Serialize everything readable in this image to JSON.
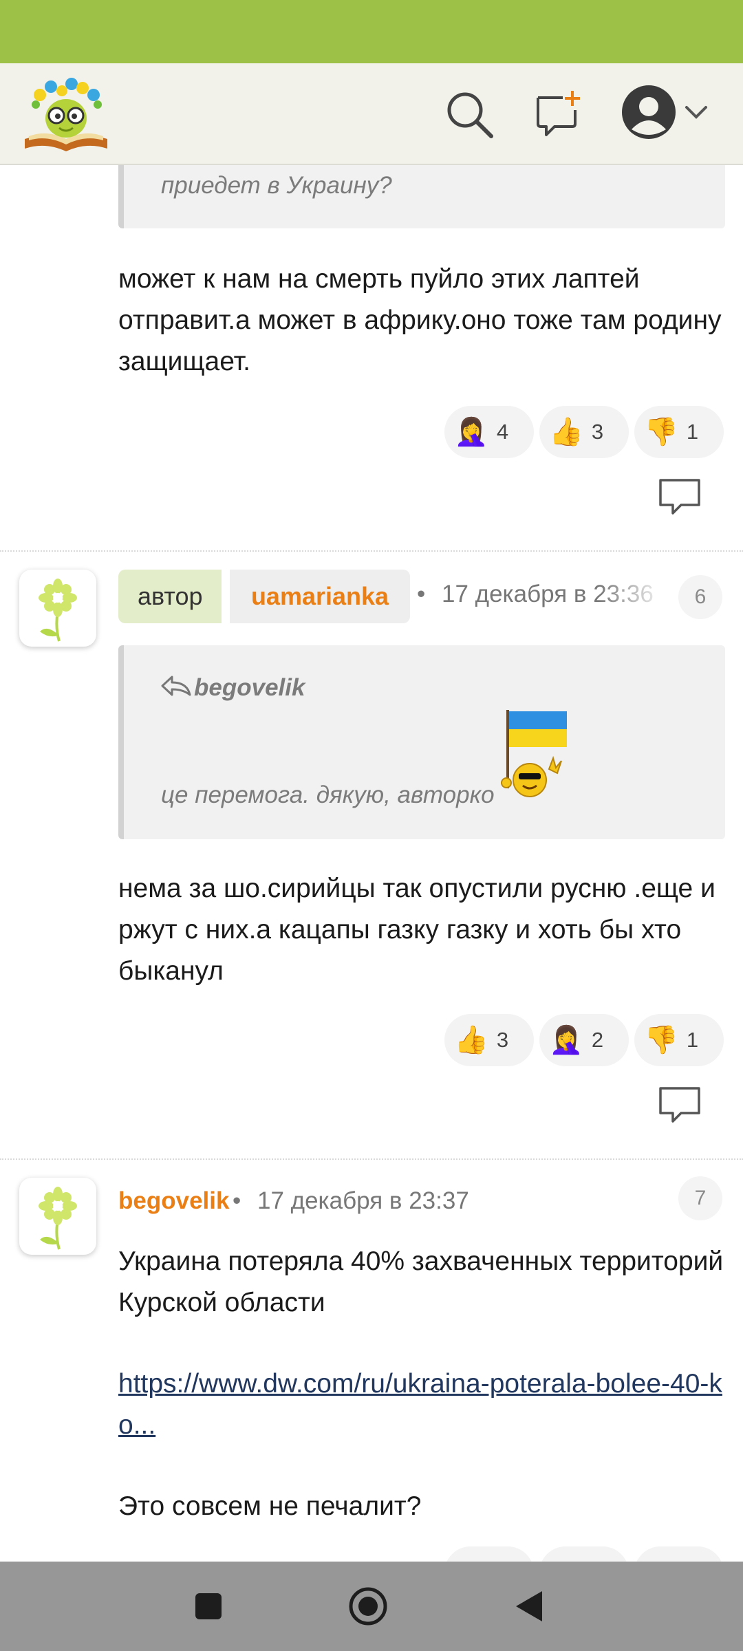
{
  "header": {
    "logo_name": "site-logo",
    "icons": [
      "search-icon",
      "new-message-icon",
      "account-icon",
      "chevron-down-icon"
    ]
  },
  "comment_prev": {
    "quote_text": "приедет в Украину?",
    "text": "может к нам на смерть пуйло этих лаптей отправит.а может в африку.оно тоже там родину защищает.",
    "reactions": [
      {
        "emoji": "🤦‍♀️",
        "name": "facepalm",
        "count": "4"
      },
      {
        "emoji": "👍",
        "name": "thumbs-up",
        "count": "3"
      },
      {
        "emoji": "👎",
        "name": "thumbs-down",
        "count": "1"
      }
    ]
  },
  "comment_6": {
    "badge_label": "автор",
    "username": "uamarianka",
    "timestamp": "17 декабря в 23:36",
    "number": "6",
    "quote_author": "begovelik",
    "quote_text": "це перемога. дякую, авторко",
    "text": "нема за шо.сирийцы так опустили русню .еще и ржут с них.а кацапы газку газку и хоть бы хто быканул",
    "reactions": [
      {
        "emoji": "👍",
        "name": "thumbs-up",
        "count": "3"
      },
      {
        "emoji": "🤦‍♀️",
        "name": "facepalm",
        "count": "2"
      },
      {
        "emoji": "👎",
        "name": "thumbs-down",
        "count": "1"
      }
    ]
  },
  "comment_7": {
    "username": "begovelik",
    "timestamp": "17 декабря в 23:37",
    "number": "7",
    "text_line1": "Украина потеряла 40% захваченных территорий Курской области",
    "link": "https://www.dw.com/ru/ukraina-poterala-bolee-40-ko...",
    "text_line2": "Это совсем не печалит?"
  },
  "colors": {
    "status_bar": "#9dc147",
    "username": "#ea7f16",
    "link": "#21375d",
    "header_bg": "#f2f2eb"
  },
  "navbar": {
    "buttons": [
      "recents-button",
      "home-button",
      "back-button"
    ]
  }
}
